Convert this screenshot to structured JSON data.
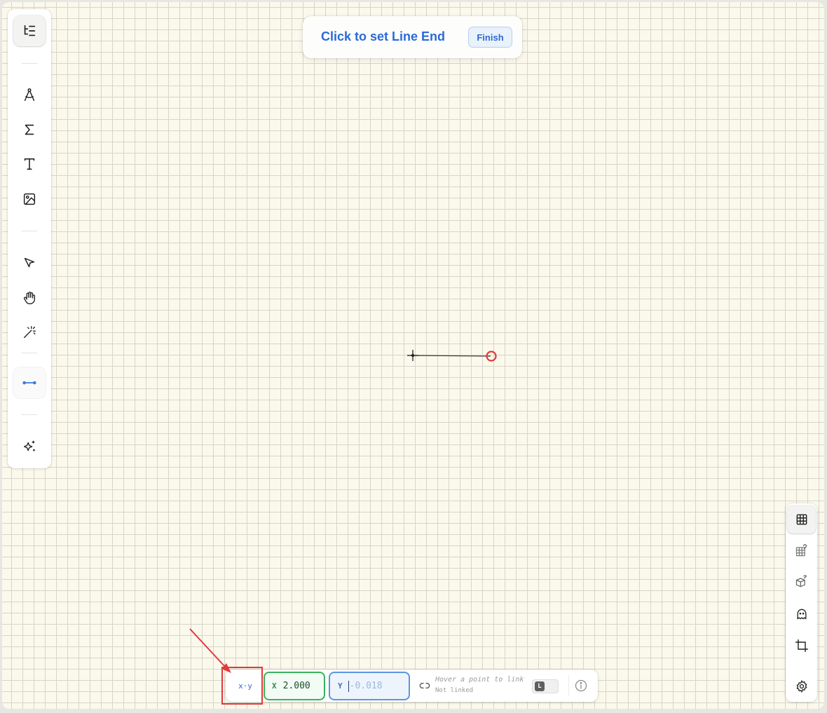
{
  "window": {
    "background": "#fbf8ec",
    "grid_color": "#d7d4c8"
  },
  "toolbar_left": {
    "tools": [
      {
        "name": "outline-icon",
        "active": true
      },
      {
        "name": "compass-icon"
      },
      {
        "name": "sigma-icon"
      },
      {
        "name": "text-icon"
      },
      {
        "name": "image-icon"
      },
      {
        "name": "pointer-icon"
      },
      {
        "name": "hand-icon"
      },
      {
        "name": "magic-wand-icon"
      },
      {
        "name": "line-segment-icon",
        "active": true
      },
      {
        "name": "sparkles-icon"
      }
    ]
  },
  "banner": {
    "text": "Click to set Line End",
    "finish_label": "Finish",
    "color": "#2a6ad8"
  },
  "drawing": {
    "line_color": "#333333",
    "end_marker_color": "#e03a3a"
  },
  "coord_bar": {
    "mode_label": "x·y",
    "x_label": "X",
    "x_value": "2.000",
    "y_label": "Y",
    "y_placeholder": "-0.018",
    "link_hint": "Hover a point to link",
    "link_status": "Not linked",
    "link_key": "L",
    "colors": {
      "x_border": "#34b45a",
      "y_border": "#5b95e0"
    }
  },
  "toolbar_right": {
    "tools": [
      {
        "name": "grid-icon",
        "active": true
      },
      {
        "name": "grid-snap-icon"
      },
      {
        "name": "cube-snap-icon"
      },
      {
        "name": "ghost-icon"
      },
      {
        "name": "crop-icon"
      },
      {
        "name": "settings-icon"
      }
    ]
  },
  "annotation": {
    "color": "#e03a3a"
  }
}
